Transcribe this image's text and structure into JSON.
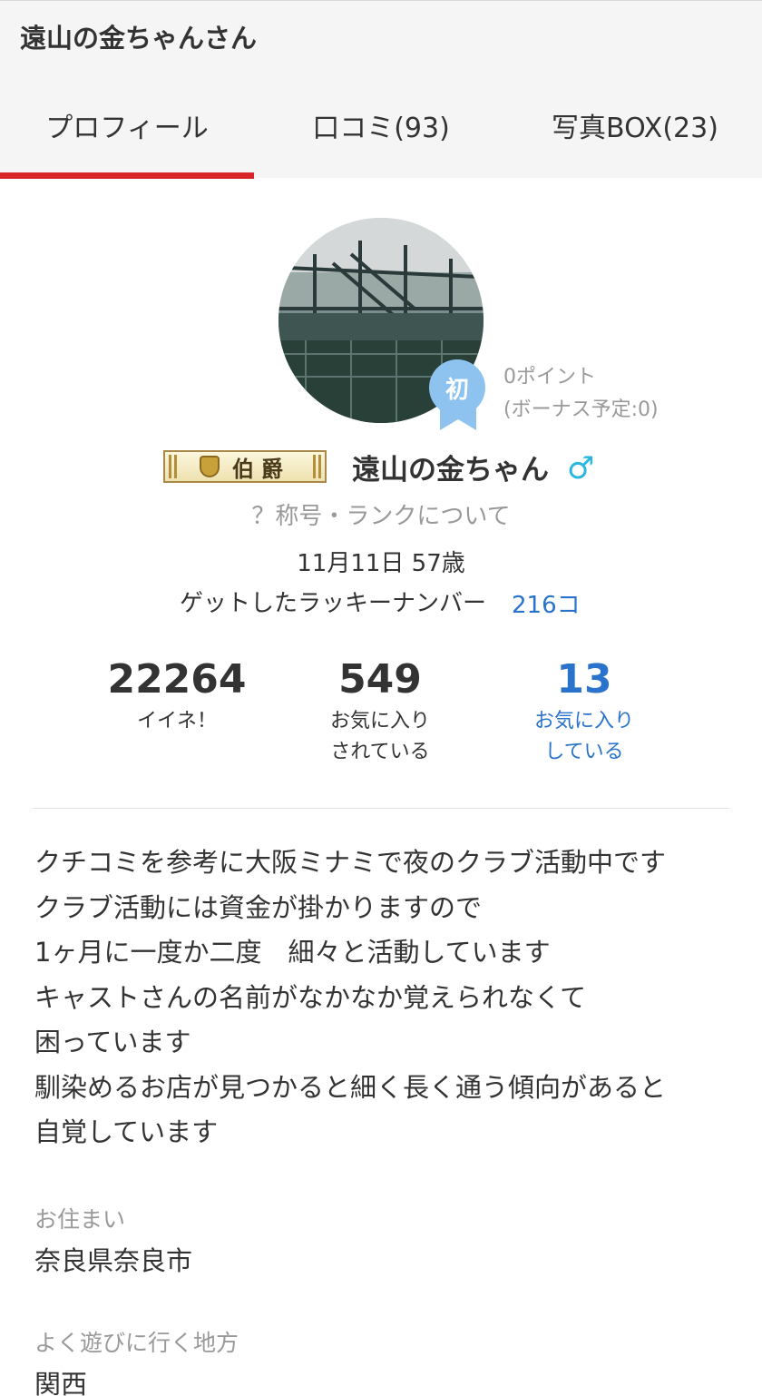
{
  "header": {
    "title": "遠山の金ちゃんさん"
  },
  "tabs": [
    {
      "label": "プロフィール"
    },
    {
      "label": "口コミ(93)"
    },
    {
      "label": "写真BOX(23)"
    }
  ],
  "profile": {
    "badge": "初",
    "points": "0ポイント",
    "bonus": "(ボーナス予定:0)",
    "rank": "伯爵",
    "name": "遠山の金ちゃん",
    "gender_symbol": "♂",
    "rank_link": "？称号・ランクについて",
    "birthday": "11月11日 57歳",
    "lucky_label": "ゲットしたラッキーナンバー",
    "lucky_value": "216コ"
  },
  "stats": [
    {
      "value": "22264",
      "label1": "イイネ！",
      "label2": ""
    },
    {
      "value": "549",
      "label1": "お気に入り",
      "label2": "されている"
    },
    {
      "value": "13",
      "label1": "お気に入り",
      "label2": "している"
    }
  ],
  "bio": [
    "クチコミを参考に大阪ミナミで夜のクラブ活動中です",
    "クラブ活動には資金が掛かりますので",
    "1ヶ月に一度か二度　細々と活動しています",
    "キャストさんの名前がなかなか覚えられなくて",
    "困っています",
    "馴染めるお店が見つかると細く長く通う傾向があると",
    "自覚しています"
  ],
  "residence": {
    "label": "お住まい",
    "value": "奈良県奈良市"
  },
  "area": {
    "label": "よく遊びに行く地方",
    "value": "関西"
  },
  "colors": {
    "accent": "#d9252a",
    "link": "#2a73cc",
    "badge": "#8ec3f0",
    "gender": "#2bb6e0"
  }
}
